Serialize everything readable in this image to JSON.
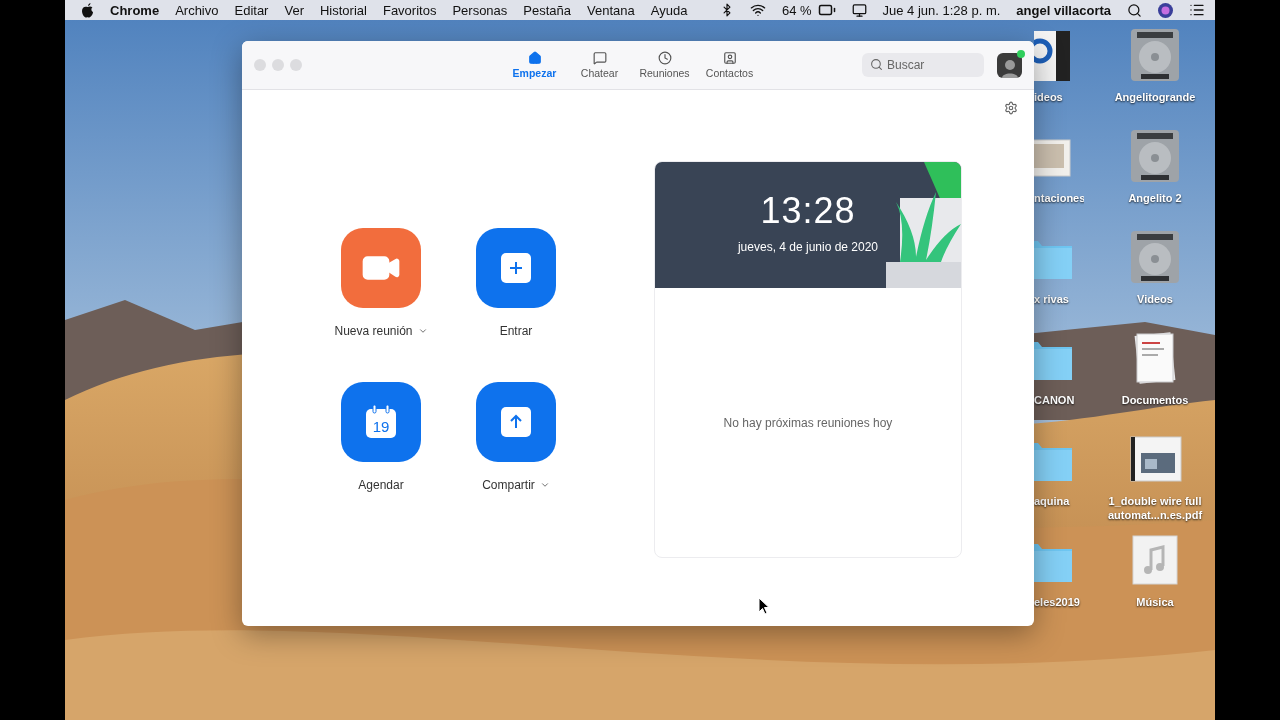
{
  "menubar": {
    "app": "Chrome",
    "menus": [
      "Archivo",
      "Editar",
      "Ver",
      "Historial",
      "Favoritos",
      "Personas",
      "Pestaña",
      "Ventana",
      "Ayuda"
    ],
    "battery": "64 %",
    "clock": "Jue 4 jun.  1:28 p. m.",
    "user": "angel villacorta"
  },
  "desktop": {
    "partial_icons": [
      {
        "label": "ideos",
        "kind": "video"
      },
      {
        "label": "ntaciones",
        "kind": "slides"
      },
      {
        "label": "x rivas",
        "kind": "folder"
      },
      {
        "label": "CANON",
        "kind": "folder"
      },
      {
        "label": "aquina",
        "kind": "folder"
      },
      {
        "label": "eles2019",
        "kind": "folder"
      }
    ],
    "icons": [
      {
        "label": "Angelitogrande",
        "kind": "drive"
      },
      {
        "label": "Angelito 2",
        "kind": "drive"
      },
      {
        "label": "Videos",
        "kind": "drive"
      },
      {
        "label": "Documentos",
        "kind": "docs"
      },
      {
        "label": "1_double wire full automat...n.es.pdf",
        "kind": "pdf"
      },
      {
        "label": "Música",
        "kind": "music"
      }
    ]
  },
  "window": {
    "tabs": [
      {
        "label": "Empezar",
        "kind": "home",
        "selected": true
      },
      {
        "label": "Chatear",
        "kind": "chat",
        "selected": false
      },
      {
        "label": "Reuniones",
        "kind": "clock",
        "selected": false
      },
      {
        "label": "Contactos",
        "kind": "contact",
        "selected": false
      }
    ],
    "search": {
      "placeholder": "Buscar"
    },
    "actions": [
      {
        "label": "Nueva reunión",
        "kind": "video",
        "has_menu": true
      },
      {
        "label": "Entrar",
        "kind": "plus",
        "has_menu": false
      },
      {
        "label": "Agendar",
        "kind": "calendar",
        "day": "19",
        "has_menu": false
      },
      {
        "label": "Compartir",
        "kind": "share",
        "has_menu": true
      }
    ],
    "calendar": {
      "time": "13:28",
      "date": "jueves, 4 de junio de 2020",
      "empty_text": "No hay próximas reuniones hoy"
    }
  }
}
